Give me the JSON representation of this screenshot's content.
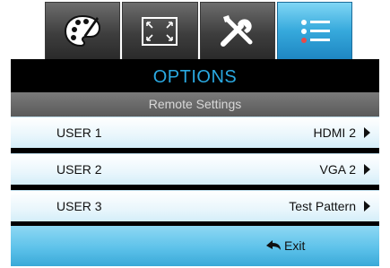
{
  "tabs": [
    {
      "icon": "palette-icon",
      "active": false
    },
    {
      "icon": "aspect-ratio-icon",
      "active": false
    },
    {
      "icon": "tools-icon",
      "active": false
    },
    {
      "icon": "options-list-icon",
      "active": true
    }
  ],
  "menu": {
    "title": "OPTIONS",
    "subtitle": "Remote Settings",
    "rows": [
      {
        "label": "USER 1",
        "value": "HDMI 2"
      },
      {
        "label": "USER 2",
        "value": "VGA 2"
      },
      {
        "label": "USER 3",
        "value": "Test Pattern"
      }
    ],
    "exit_label": "Exit"
  },
  "colors": {
    "accent": "#2aa8e0",
    "tab_active": "#36a9dc",
    "footer": "#5dc2ea"
  }
}
